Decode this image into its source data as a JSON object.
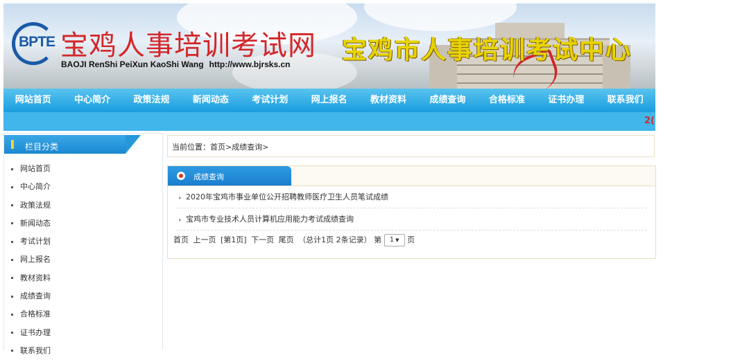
{
  "header": {
    "logo_text": "BPTE",
    "site_title": "宝鸡人事培训考试网",
    "site_subtitle": "BAOJI RenShi PeiXun KaoShi Wang",
    "site_url": "http://www.bjrsks.cn",
    "center_title": "宝鸡市人事培训考试中心"
  },
  "nav": {
    "items": [
      "网站首页",
      "中心简介",
      "政策法规",
      "新闻动态",
      "考试计划",
      "网上报名",
      "教材资料",
      "成绩查询",
      "合格标准",
      "证书办理",
      "联系我们"
    ]
  },
  "marquee": {
    "text": "2("
  },
  "sidebar": {
    "title": "栏目分类",
    "items": [
      "网站首页",
      "中心简介",
      "政策法规",
      "新闻动态",
      "考试计划",
      "网上报名",
      "教材资料",
      "成绩查询",
      "合格标准",
      "证书办理",
      "联系我们"
    ]
  },
  "breadcrumb": {
    "text": "当前位置：首页>成绩查询>"
  },
  "panel": {
    "title": "成绩查询",
    "articles": [
      "2020年宝鸡市事业单位公开招聘教师医疗卫生人员笔试成绩",
      "宝鸡市专业技术人员计算机应用能力考试成绩查询"
    ]
  },
  "pager": {
    "first": "首页",
    "prev": "上一页",
    "current": "[第1页]",
    "next": "下一页",
    "last": "尾页",
    "summary": "（总计1页 2条记录）",
    "jump_prefix": "第",
    "selected_page": "1",
    "jump_suffix": "页"
  },
  "colors": {
    "nav_blue": "#1a9ddf",
    "title_red": "#d3262a",
    "center_yellow": "#e8d400",
    "border_tan": "#e8dfc4"
  }
}
